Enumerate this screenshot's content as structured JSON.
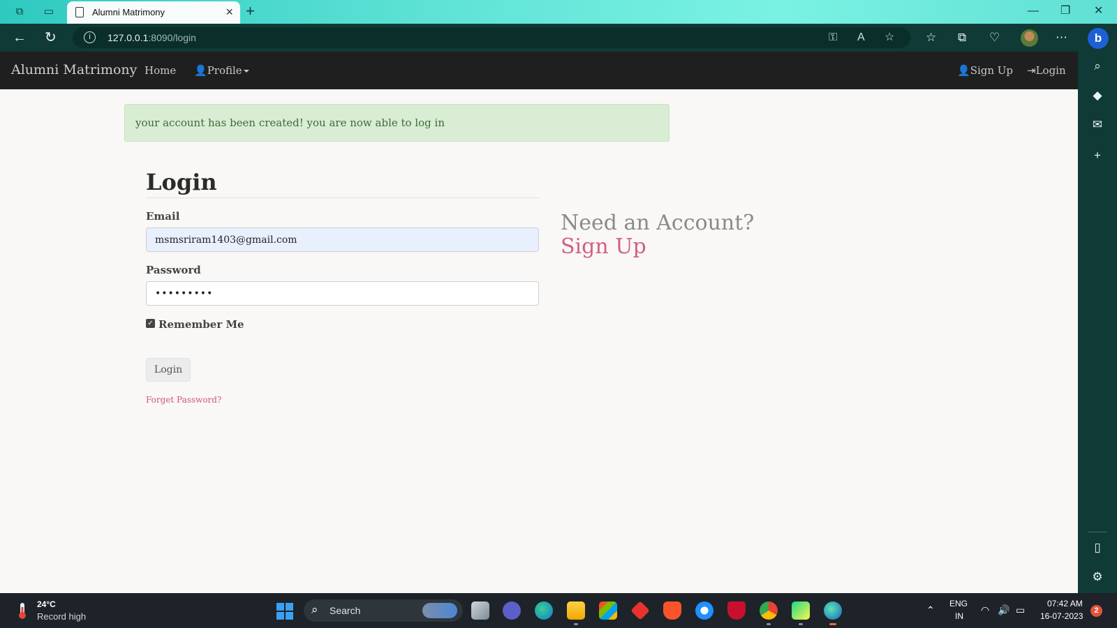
{
  "browser": {
    "tab_title": "Alumni Matrimony",
    "url_host": "127.0.0.1",
    "url_rest": ":8090/login",
    "theme_colors": {
      "tabbar": "#5fe3d6",
      "toolbar": "#0f3a35"
    }
  },
  "navbar": {
    "brand": "Alumni Matrimony",
    "home": "Home",
    "profile": "Profile",
    "signup": "Sign Up",
    "login": "Login"
  },
  "alert": {
    "message": "your account has been created! you are now able to log in"
  },
  "form": {
    "title": "Login",
    "email_label": "Email",
    "email_value": "msmsriram1403@gmail.com",
    "password_label": "Password",
    "password_value": "•••••••••",
    "remember_label": "Remember Me",
    "remember_checked": true,
    "submit_label": "Login",
    "forgot_label": "Forget Password?"
  },
  "side": {
    "need_account": "Need an Account?",
    "signup_link": "Sign Up",
    "link_color": "#d35d85"
  },
  "taskbar": {
    "weather_temp": "24°C",
    "weather_desc": "Record high",
    "search_label": "Search",
    "lang_top": "ENG",
    "lang_bottom": "IN",
    "time": "07:42 AM",
    "date": "16-07-2023",
    "notification_count": "2"
  }
}
